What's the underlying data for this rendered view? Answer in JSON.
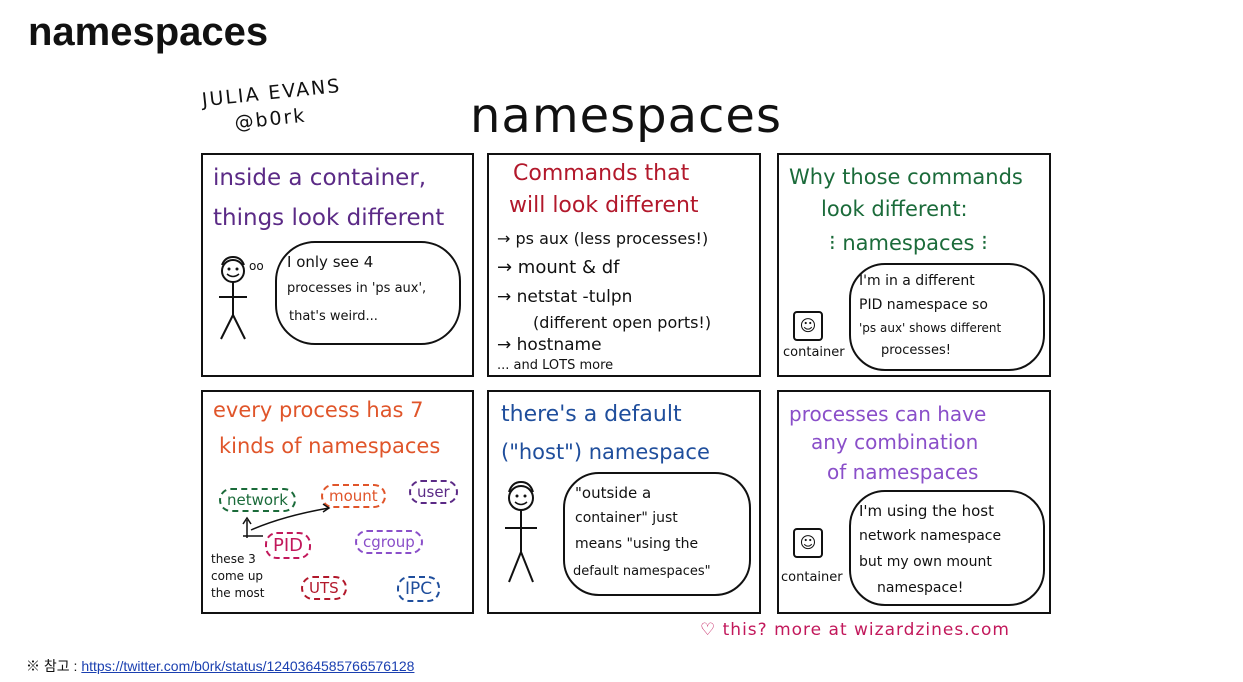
{
  "slide": {
    "title": "namespaces"
  },
  "zine": {
    "author_name": "JULIA EVANS",
    "author_handle": "@b0rk",
    "title": "namespaces",
    "footer": "♡ this? more at wizardzines.com"
  },
  "panels": [
    {
      "title_line1": "inside a container,",
      "title_line2": "things look different",
      "thought": [
        "I only see 4",
        "processes in 'ps aux',",
        "that's weird..."
      ],
      "thought_dots": "oo"
    },
    {
      "title_line1": "Commands that",
      "title_line2": "will look different",
      "items": [
        "→ ps aux (less processes!)",
        "→ mount & df",
        "→ netstat -tulpn",
        "(different open ports!)",
        "→ hostname",
        "... and LOTS more"
      ]
    },
    {
      "title_line1": "Why those commands",
      "title_line2": "look different:",
      "title_line3": "⁝ namespaces ⁝",
      "speech": [
        "I'm in a different",
        "PID namespace so",
        "'ps aux' shows different",
        "processes!"
      ],
      "label": "container"
    },
    {
      "title_line1": "every process has 7",
      "title_line2": "kinds of namespaces",
      "tags": [
        "network",
        "mount",
        "user",
        "PID",
        "cgroup",
        "UTS",
        "IPC"
      ],
      "note": [
        "these 3",
        "come up",
        "the most"
      ]
    },
    {
      "title_line1": "there's a default",
      "title_line2": "(\"host\") namespace",
      "speech": [
        "\"outside a",
        "container\" just",
        "means \"using the",
        "default namespaces\""
      ]
    },
    {
      "title_line1": "processes can have",
      "title_line2": "any combination",
      "title_line3": "of namespaces",
      "speech": [
        "I'm using the host",
        "network namespace",
        "but my own mount",
        "namespace!"
      ],
      "label": "container"
    }
  ],
  "reference": {
    "prefix": "※ 참고 : ",
    "link_text": "https://twitter.com/b0rk/status/1240364585766576128"
  },
  "colors": {
    "panel1": "#5b2a86",
    "panel2": "#b2182b",
    "panel3": "#1b6b3a",
    "panel4": "#e0552a",
    "panel5": "#1f4e9c",
    "panel6": "#8a4fc9",
    "footer": "#c2185b"
  }
}
